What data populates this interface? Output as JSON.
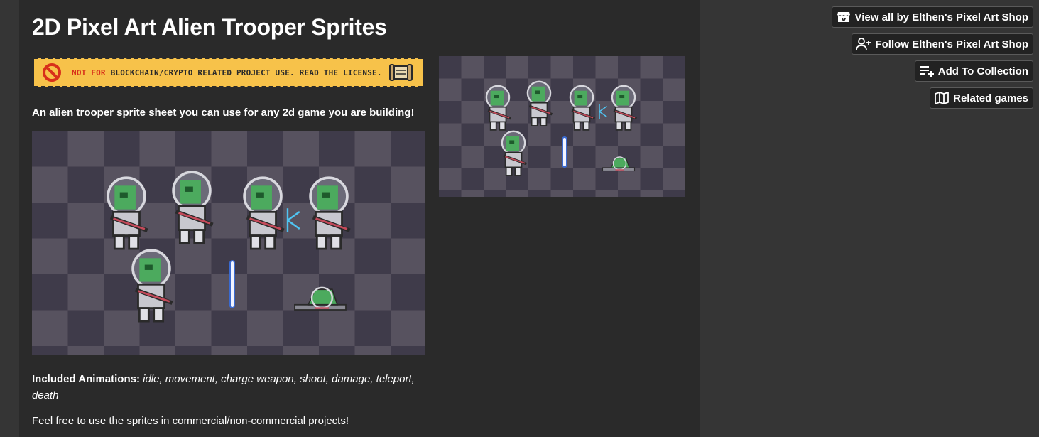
{
  "page": {
    "title": "2D Pixel Art Alien Trooper Sprites",
    "banner": {
      "warn": "NOT FOR",
      "text": "BLOCKCHAIN/CRYPTO RELATED PROJECT USE. READ THE LICENSE.",
      "colors": {
        "bg": "#f7c24a",
        "accent": "#d8301a"
      }
    },
    "intro": "An  alien trooper sprite sheet you can use for any 2d game you are building!",
    "animations_label": "Included Animations:",
    "animations_list": " idle, movement, charge weapon, shoot, damage, teleport, death",
    "feel_free": "Feel free to use the sprites in commercial/non-commercial projects!"
  },
  "sidebar": {
    "view_all": {
      "label": "View all by Elthen's Pixel Art Shop",
      "icon": "itch-icon"
    },
    "follow": {
      "label": "Follow Elthen's Pixel Art Shop",
      "icon": "user-plus-icon"
    },
    "add_collection": {
      "label": "Add To Collection",
      "icon": "list-plus-icon"
    },
    "related": {
      "label": "Related games",
      "icon": "map-icon"
    }
  },
  "colors": {
    "page_bg": "#353535",
    "content_bg": "#2a2a2a",
    "checker_dark": "#3f3b4a",
    "checker_light": "#57525f",
    "alien_green": "#4caa5e"
  }
}
